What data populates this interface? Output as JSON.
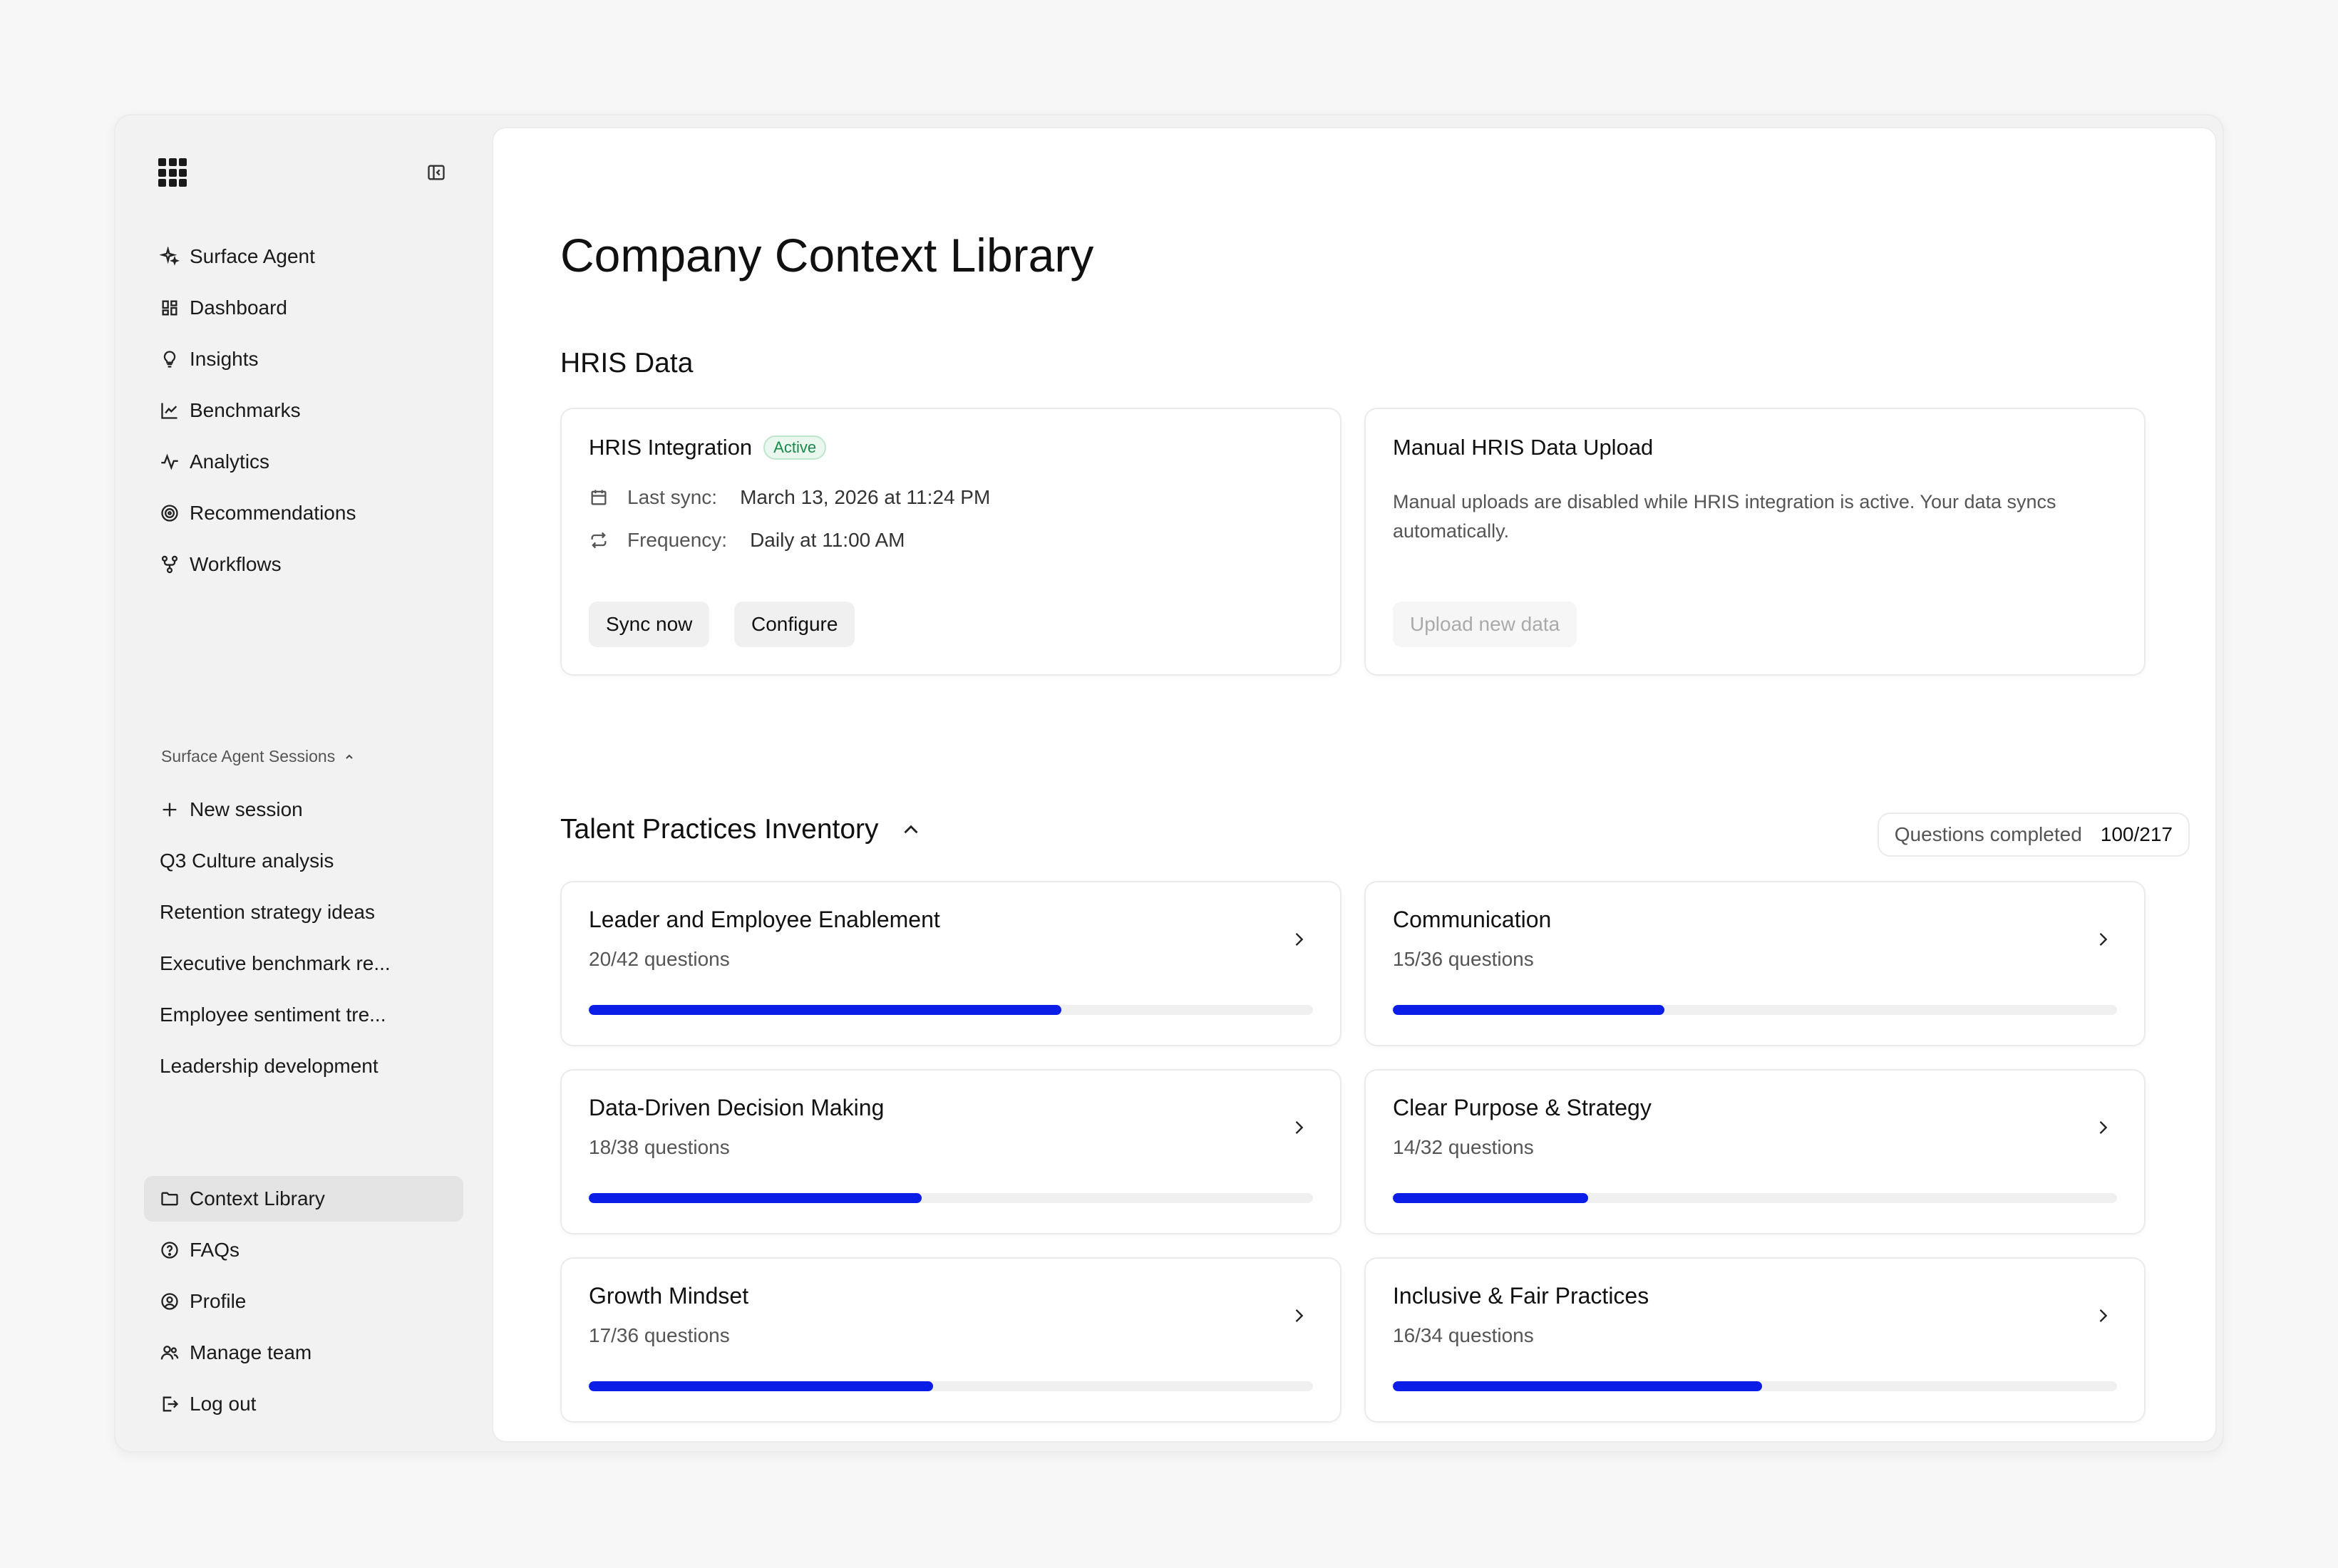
{
  "sidebar": {
    "primary": [
      {
        "label": "Surface Agent",
        "icon": "sparkle-icon"
      },
      {
        "label": "Dashboard",
        "icon": "dashboard-icon"
      },
      {
        "label": "Insights",
        "icon": "lightbulb-icon"
      },
      {
        "label": "Benchmarks",
        "icon": "chart-line-icon"
      },
      {
        "label": "Analytics",
        "icon": "activity-icon"
      },
      {
        "label": "Recommendations",
        "icon": "target-icon"
      },
      {
        "label": "Workflows",
        "icon": "workflow-icon"
      }
    ],
    "sessions_label": "Surface Agent Sessions",
    "new_session": "New session",
    "sessions": [
      "Q3 Culture analysis",
      "Retention strategy ideas",
      "Executive benchmark re...",
      "Employee sentiment tre...",
      "Leadership development"
    ],
    "bottom": [
      {
        "label": "Context Library",
        "icon": "folder-icon",
        "active": true
      },
      {
        "label": "FAQs",
        "icon": "help-circle-icon"
      },
      {
        "label": "Profile",
        "icon": "user-circle-icon"
      },
      {
        "label": "Manage team",
        "icon": "users-icon"
      },
      {
        "label": "Log out",
        "icon": "logout-icon"
      }
    ]
  },
  "main": {
    "title": "Company Context Library",
    "hris": {
      "section_title": "HRIS Data",
      "integration": {
        "title": "HRIS Integration",
        "badge": "Active",
        "last_sync_label": "Last sync:",
        "last_sync_value": "March 13, 2026 at 11:24 PM",
        "frequency_label": "Frequency:",
        "frequency_value": "Daily at 11:00 AM",
        "sync_button": "Sync now",
        "configure_button": "Configure"
      },
      "manual": {
        "title": "Manual HRIS Data Upload",
        "description": "Manual uploads are disabled while HRIS integration is active. Your data syncs automatically.",
        "upload_button": "Upload new data"
      }
    },
    "talent": {
      "section_title": "Talent Practices Inventory",
      "questions_label": "Questions completed",
      "questions_value": "100/217",
      "practices": [
        {
          "title": "Leader and Employee Enablement",
          "subtitle": "20/42 questions",
          "progress": 0.653
        },
        {
          "title": "Communication",
          "subtitle": "15/36 questions",
          "progress": 0.375
        },
        {
          "title": "Data-Driven Decision Making",
          "subtitle": "18/38 questions",
          "progress": 0.46
        },
        {
          "title": "Clear Purpose & Strategy",
          "subtitle": "14/32 questions",
          "progress": 0.27
        },
        {
          "title": "Growth Mindset",
          "subtitle": "17/36 questions",
          "progress": 0.475
        },
        {
          "title": "Inclusive & Fair Practices",
          "subtitle": "16/34 questions",
          "progress": 0.51
        }
      ]
    }
  }
}
